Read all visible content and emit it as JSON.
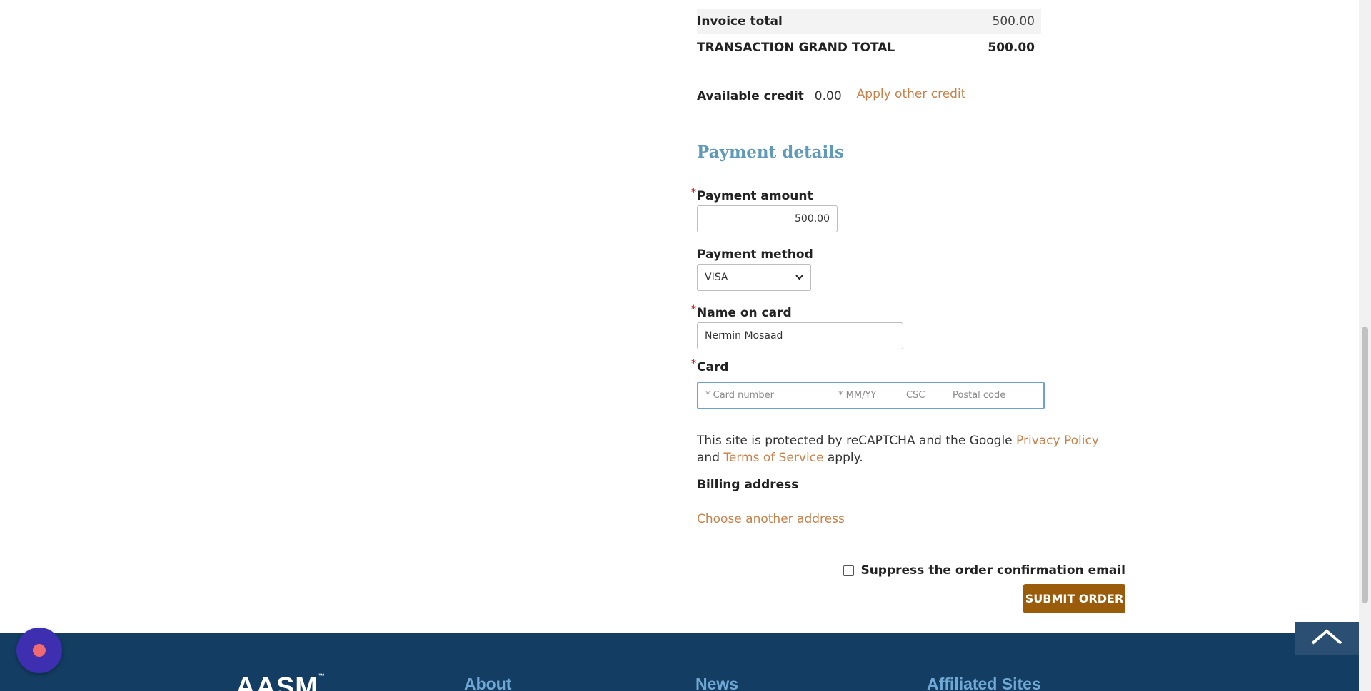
{
  "totals": {
    "invoice_label": "Invoice total",
    "invoice_value": "500.00",
    "grand_label": "TRANSACTION GRAND TOTAL",
    "grand_value": "500.00"
  },
  "credit": {
    "label": "Available credit",
    "value": "0.00",
    "apply_link": "Apply other credit"
  },
  "payment": {
    "title": "Payment details",
    "required_marker": "*",
    "amount_label": "Payment amount",
    "amount_value": "500.00",
    "method_label": "Payment method",
    "method_value": "VISA",
    "name_label": "Name on card",
    "name_value": "Nermin Mosaad",
    "card_label": "Card",
    "card_number_placeholder": "* Card number",
    "card_expiry_placeholder": "* MM/YY",
    "card_csc_placeholder": "CSC",
    "card_postal_placeholder": "Postal code"
  },
  "recaptcha": {
    "text_before": "This site is protected by reCAPTCHA and the Google ",
    "privacy_link": "Privacy Policy",
    "and_text": " and ",
    "terms_link": "Terms of Service",
    "text_after": " apply."
  },
  "billing": {
    "label": "Billing address",
    "choose_link": "Choose another address"
  },
  "order": {
    "suppress_label": "Suppress the order confirmation email",
    "submit_label": "SUBMIT ORDER"
  },
  "footer": {
    "logo_text": "AASM",
    "logo_mark": "™",
    "columns": [
      "About",
      "News",
      "Affiliated Sites"
    ]
  },
  "icons": {
    "select_chevron": "chevron-down-icon",
    "back_to_top": "chevron-up-icon",
    "chat": "chat-launcher-icon"
  },
  "colors": {
    "link": "#c8814a",
    "section_title": "#5f9ab8",
    "submit_button": "#9a5c0b",
    "footer": "#133d62",
    "chat_button": "#3d2fb0",
    "card_focus": "#6aa1d8"
  }
}
